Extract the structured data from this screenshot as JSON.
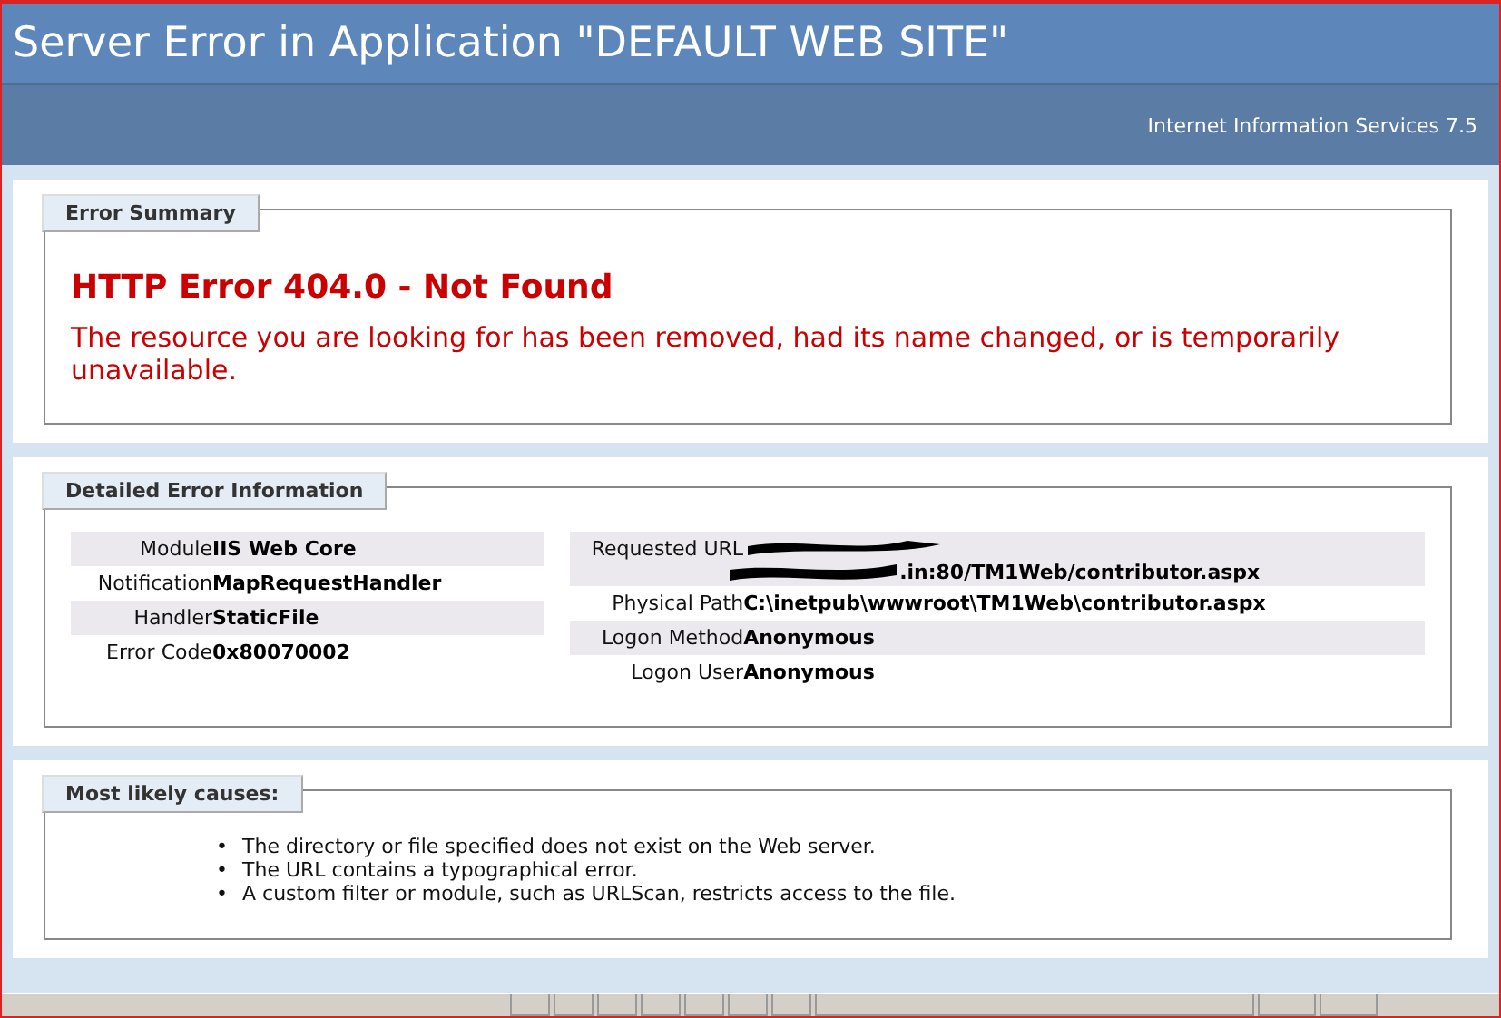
{
  "header": {
    "title": "Server Error in Application \"DEFAULT WEB SITE\"",
    "product": "Internet Information Services 7.5"
  },
  "summary": {
    "legend": "Error Summary",
    "heading": "HTTP Error 404.0 - Not Found",
    "message": "The resource you are looking for has been removed, had its name changed, or is temporarily unavailable."
  },
  "details": {
    "legend": "Detailed Error Information",
    "left": [
      {
        "label": "Module",
        "value": "IIS Web Core",
        "shaded": true
      },
      {
        "label": "Notification",
        "value": "MapRequestHandler",
        "shaded": false
      },
      {
        "label": "Handler",
        "value": "StaticFile",
        "shaded": true
      },
      {
        "label": "Error Code",
        "value": "0x80070002",
        "shaded": false
      }
    ],
    "right": [
      {
        "label": "Requested URL",
        "value": ".in:80/TM1Web/contributor.aspx",
        "redacted": true,
        "shaded": true
      },
      {
        "label": "Physical Path",
        "value": "C:\\inetpub\\wwwroot\\TM1Web\\contributor.aspx",
        "redacted": false,
        "shaded": false
      },
      {
        "label": "Logon Method",
        "value": "Anonymous",
        "redacted": false,
        "shaded": true
      },
      {
        "label": "Logon User",
        "value": "Anonymous",
        "redacted": false,
        "shaded": false
      }
    ]
  },
  "causes": {
    "legend": "Most likely causes:",
    "items": [
      {
        "marker": "•",
        "text": "The directory or file specified does not exist on the Web server."
      },
      {
        "marker": "•",
        "text": "The URL contains a typographical error."
      },
      {
        "marker": "•",
        "text": "A custom filter or module, such as URLScan, restricts access to the file."
      }
    ]
  }
}
